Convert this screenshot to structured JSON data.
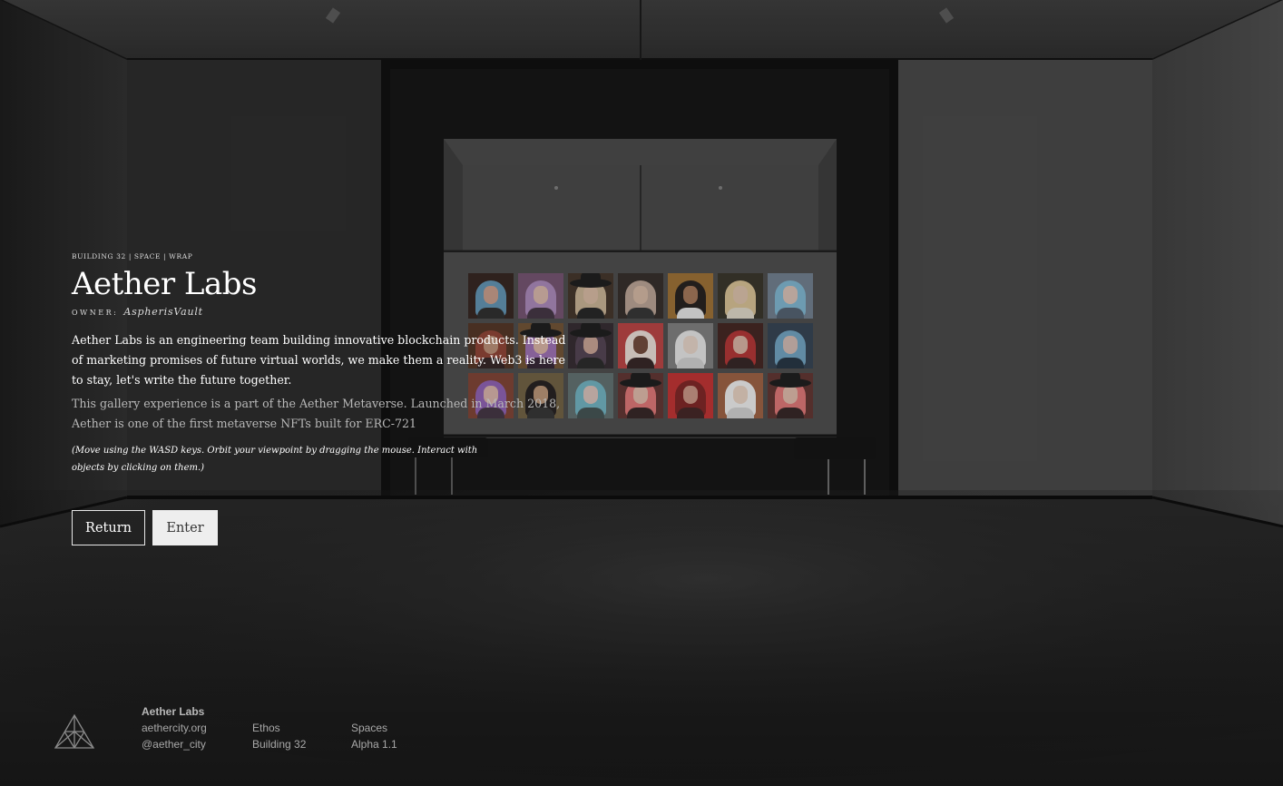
{
  "space": {
    "breadcrumb": "BUILDING 32 | SPACE | WRAP",
    "title": "Aether Labs",
    "owner_label": "OWNER:",
    "owner_name": "AspherisVault",
    "description": "Aether Labs is an engineering team building innovative blockchain products. Instead of marketing promises of future virtual worlds, we make them a reality. Web3 is here to stay, let's write the future together.",
    "description_secondary": "This gallery experience is a part of the Aether Metaverse. Launched in March 2018, Aether is one of the first metaverse NFTs built for ERC-721",
    "controls_hint": "(Move using the WASD keys. Orbit your viewpoint by dragging the mouse. Interact with objects by clicking on them.)"
  },
  "buttons": {
    "return_label": "Return",
    "enter_label": "Enter"
  },
  "footer": {
    "brand": "Aether Labs",
    "website": "aethercity.org",
    "handle": "@aether_city",
    "ethos_link": "Ethos",
    "building_link": "Building 32",
    "spaces_link": "Spaces",
    "version": "Alpha 1.1"
  },
  "colors": {
    "background": "#1a1a1a",
    "button_primary_bg": "#eeeeee",
    "text_primary": "#ffffff",
    "text_muted": "#a8a8a8"
  },
  "nft_gallery": [
    {
      "bg": "#2a1a14",
      "hair": "#5a8fb0",
      "skin": "#c79a86",
      "hat": false,
      "body": "#222"
    },
    {
      "bg": "#6e4a6a",
      "hair": "#a884b8",
      "skin": "#d8b4a8",
      "hat": false,
      "body": "#3a2a3a"
    },
    {
      "bg": "#3a2a1e",
      "hair": "#c8b090",
      "skin": "#d8b8a0",
      "hat": true,
      "body": "#1a1a1a"
    },
    {
      "bg": "#2a221e",
      "hair": "#b8a090",
      "skin": "#d4b6a0",
      "hat": false,
      "body": "#2a2a2a"
    },
    {
      "bg": "#9a6a2a",
      "hair": "#1a1412",
      "skin": "#a07050",
      "hat": false,
      "body": "#e8e8e8"
    },
    {
      "bg": "#2e2a1e",
      "hair": "#d8c090",
      "skin": "#dcc0a8",
      "hat": false,
      "body": "#e0d8c8"
    },
    {
      "bg": "#6a7a8a",
      "hair": "#7ab4d0",
      "skin": "#d8c0b4",
      "hat": false,
      "body": "#4a5a6a"
    },
    {
      "bg": "#4a2a1a",
      "hair": "#8a3a2a",
      "skin": "#b88a70",
      "hat": false,
      "body": "#2a1a1a"
    },
    {
      "bg": "#6a4a2a",
      "hair": "#9a6ab0",
      "skin": "#d8b0a0",
      "hat": true,
      "body": "#2a1a2a"
    },
    {
      "bg": "#2a2026",
      "hair": "#4a3a4a",
      "skin": "#c8a090",
      "hat": true,
      "body": "#1e1e1e"
    },
    {
      "bg": "#b83a3a",
      "hair": "#ece0d8",
      "skin": "#6a4030",
      "hat": false,
      "body": "#2a1a1a"
    },
    {
      "bg": "#7a7a7a",
      "hair": "#e8e8e8",
      "skin": "#e8d4c8",
      "hat": false,
      "body": "#d0d0d0"
    },
    {
      "bg": "#3a1a16",
      "hair": "#b02a2a",
      "skin": "#d8b0a0",
      "hat": false,
      "body": "#2a1a1a"
    },
    {
      "bg": "#2a3a4a",
      "hair": "#6aa0c0",
      "skin": "#d0b8b0",
      "hat": false,
      "body": "#1a2a3a"
    },
    {
      "bg": "#7a3a2a",
      "hair": "#8a5ab0",
      "skin": "#d8b0a8",
      "hat": false,
      "body": "#3a2a3a"
    },
    {
      "bg": "#6a5a3a",
      "hair": "#1a1414",
      "skin": "#b89070",
      "hat": false,
      "body": "#2a2a2a"
    },
    {
      "bg": "#5a6a6a",
      "hair": "#6ab0c0",
      "skin": "#d8c0b8",
      "hat": false,
      "body": "#3a4a4a"
    },
    {
      "bg": "#5a2a28",
      "hair": "#e07070",
      "skin": "#e0b8a8",
      "hat": true,
      "body": "#2a1a1a"
    },
    {
      "bg": "#c02828",
      "hair": "#7a1a1a",
      "skin": "#c89080",
      "hat": false,
      "body": "#3a1a1a"
    },
    {
      "bg": "#9a5a3a",
      "hair": "#f0f0f0",
      "skin": "#e8d0c0",
      "hat": false,
      "body": "#d0d0d0"
    },
    {
      "bg": "#5a2a26",
      "hair": "#e07070",
      "skin": "#e0b8a8",
      "hat": true,
      "body": "#2a1a1a"
    }
  ]
}
